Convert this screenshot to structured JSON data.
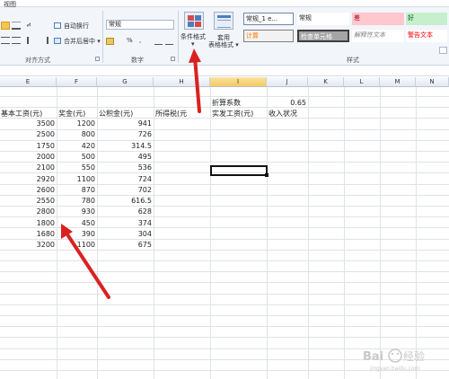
{
  "ribbon": {
    "tab_view": "视图",
    "alignment": {
      "wrap_text": "自动换行",
      "merge_center": "合并后居中 ▾",
      "group_label": "对齐方式"
    },
    "number": {
      "format_value": "常规",
      "percent": "%",
      "comma": ",",
      "group_label": "数字"
    },
    "conditional_format": {
      "label": "条件格式",
      "arrow": "▾"
    },
    "table_format": {
      "line1": "套用",
      "line2": "表格格式 ▾"
    },
    "styles": {
      "group_label": "样式",
      "items": [
        {
          "label": "常规_1 e...",
          "color": "#ffffff"
        },
        {
          "label": "常规",
          "color": "#ffffff"
        },
        {
          "label": "差",
          "color": "#ffc7ce"
        },
        {
          "label": "好",
          "color": "#c6efce"
        },
        {
          "label": "计算",
          "color": "#f2f2f2"
        },
        {
          "label": "检查单元格",
          "color": "#a5a5a5"
        },
        {
          "label": "解释性文本",
          "color": "#ffffff"
        },
        {
          "label": "警告文本",
          "color": "#ffffff"
        }
      ]
    }
  },
  "columns": [
    "E",
    "F",
    "G",
    "H",
    "I",
    "J",
    "K",
    "L",
    "M",
    "N"
  ],
  "headers": {
    "base_salary": "基本工资(元)",
    "bonus": "奖金(元)",
    "housing_fund": "公积金(元)",
    "income_tax": "所得税(元",
    "net_salary": "实发工资(元)",
    "income_status": "收入状况",
    "factor_label": "折算系数",
    "factor_value": "0.65"
  },
  "rows": [
    [
      "3500",
      "1200",
      "941"
    ],
    [
      "2500",
      "800",
      "726"
    ],
    [
      "1750",
      "420",
      "314.5"
    ],
    [
      "2000",
      "500",
      "495"
    ],
    [
      "2100",
      "550",
      "536"
    ],
    [
      "2920",
      "1100",
      "724"
    ],
    [
      "2600",
      "870",
      "702"
    ],
    [
      "2550",
      "780",
      "616.5"
    ],
    [
      "2800",
      "930",
      "628"
    ],
    [
      "1800",
      "450",
      "374"
    ],
    [
      "1680",
      "390",
      "304"
    ],
    [
      "3200",
      "1100",
      "675"
    ]
  ],
  "colors": {
    "arrow": "#d9221f",
    "selected_column": "#f5c95d",
    "ribbon_bg": "#f2f5fa"
  },
  "watermark": {
    "text": "Bai经验",
    "sub": "jingyan.baidu.com"
  }
}
